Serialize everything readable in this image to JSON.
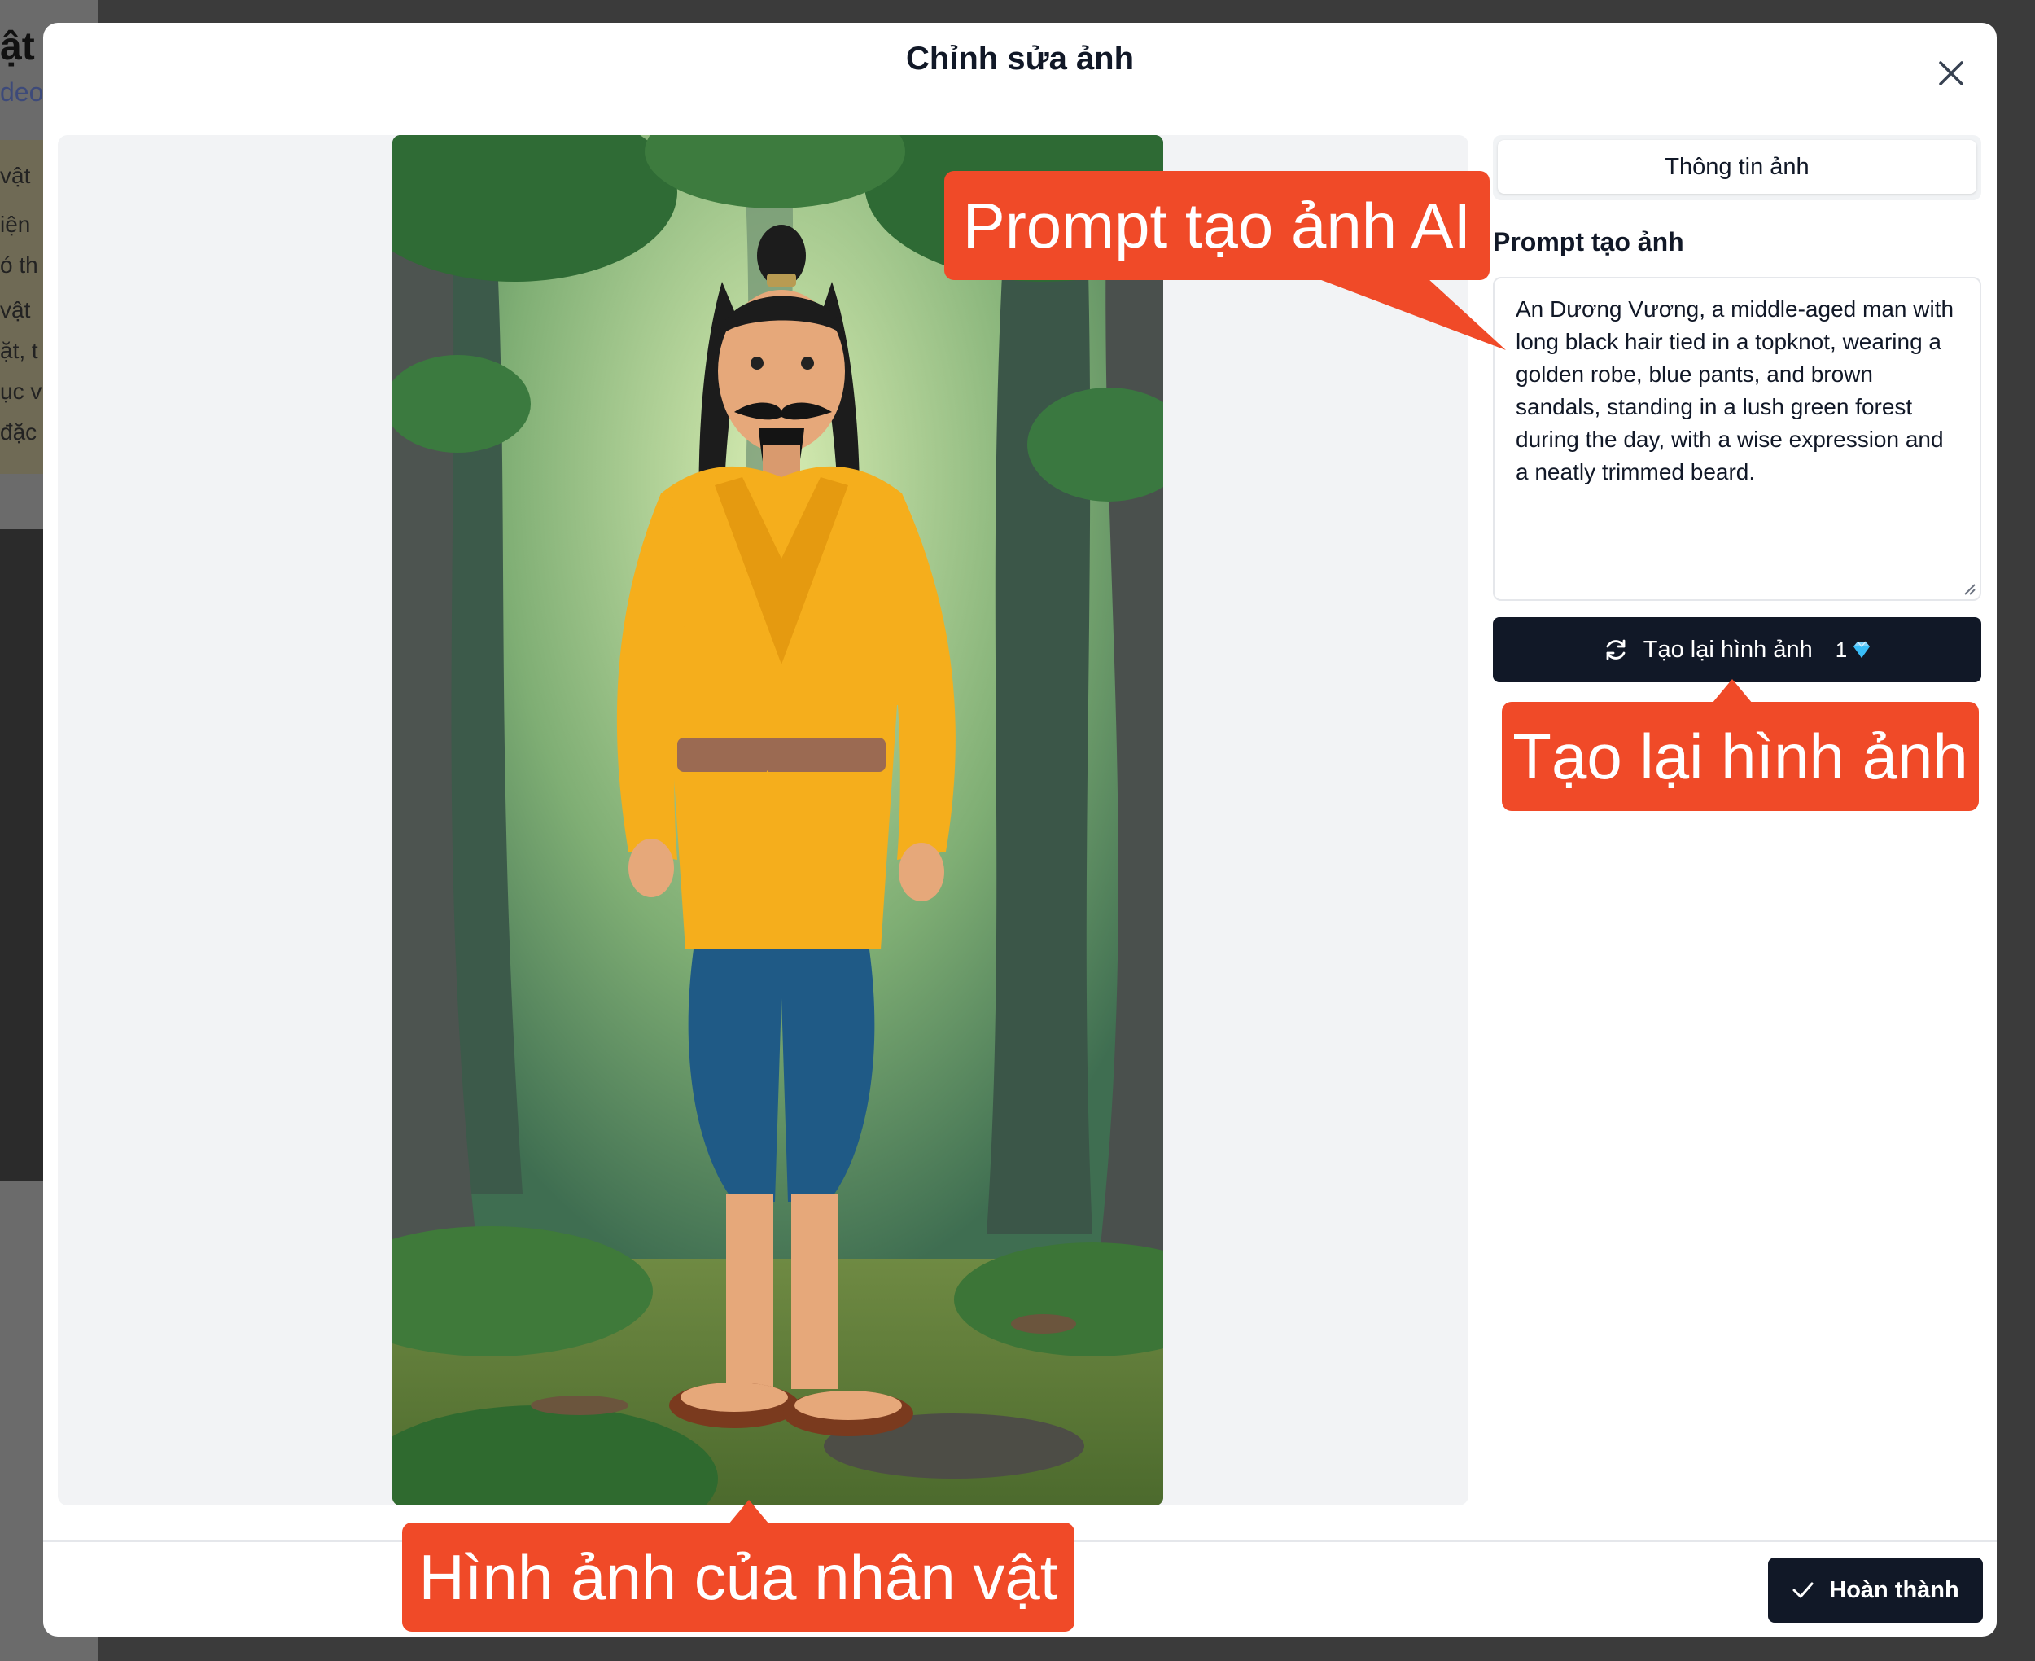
{
  "background_page": {
    "title_fragment": "ật",
    "subtitle_fragment": "deo",
    "lines": [
      "vật",
      "iện",
      "ó th",
      "vật",
      "ặt, t",
      "ục v",
      "đặc"
    ]
  },
  "modal": {
    "title": "Chỉnh sửa ảnh",
    "close_icon": "close-icon",
    "image_alt": "An Dương Vương character illustration"
  },
  "side_panel": {
    "tab_label": "Thông tin ảnh",
    "prompt_label": "Prompt tạo ảnh",
    "prompt_text": "An Dương Vương, a middle-aged man with long black hair tied in a topknot, wearing a golden robe, blue pants, and brown sandals, standing in a lush green forest during the day, with a wise expression and a neatly trimmed beard.",
    "regen_button": {
      "label": "Tạo lại hình ảnh",
      "cost": "1",
      "icon": "refresh-icon",
      "cost_icon": "gem-icon"
    }
  },
  "footer": {
    "done_label": "Hoàn thành",
    "done_icon": "check-icon"
  },
  "callouts": {
    "prompt": "Prompt tạo ảnh AI",
    "regenerate": "Tạo lại hình ảnh",
    "image": "Hình ảnh của nhân vật"
  },
  "colors": {
    "callout": "#f04a28",
    "primary_button": "#111827"
  }
}
